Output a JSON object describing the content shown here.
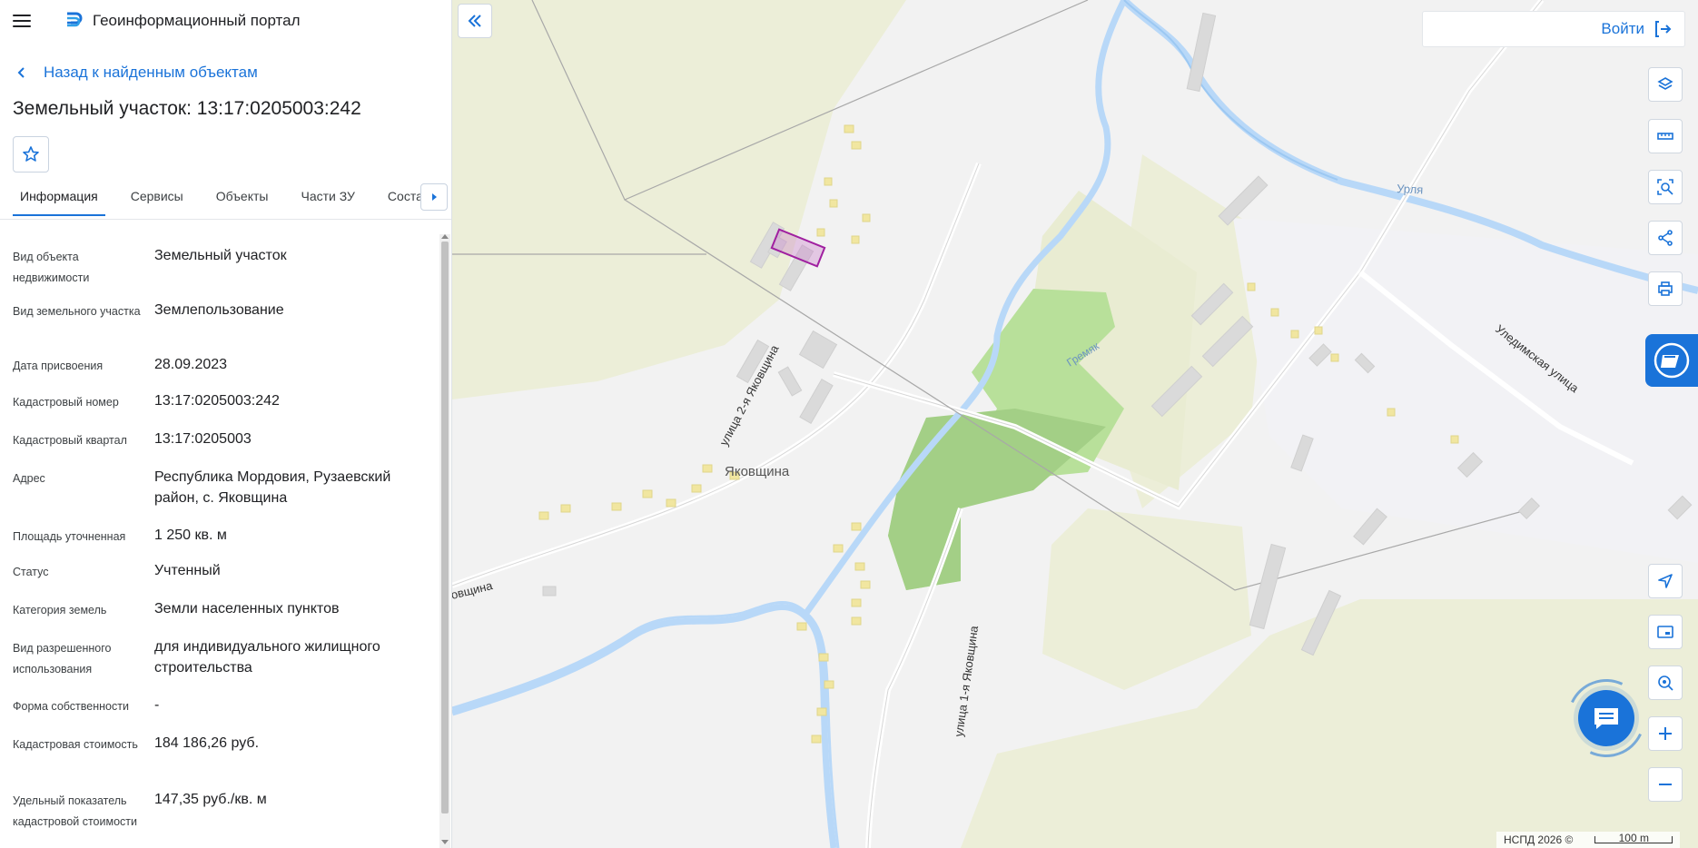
{
  "header": {
    "menu_icon": "hamburger-icon",
    "logo_icon": "portal-logo-icon",
    "title": "Геоинформационный портал"
  },
  "nav": {
    "back_label": "Назад к найденным объектам"
  },
  "object": {
    "title": "Земельный участок: 13:17:0205003:242",
    "favorite_icon": "star-icon"
  },
  "tabs": [
    {
      "label": "Информация",
      "active": true
    },
    {
      "label": "Сервисы"
    },
    {
      "label": "Объекты"
    },
    {
      "label": "Части ЗУ"
    },
    {
      "label": "Состав"
    }
  ],
  "properties": [
    {
      "key": "Вид объекта недвижимости",
      "value": "Земельный участок"
    },
    {
      "key": "Вид земельного участка",
      "value": "Землепользование"
    },
    {
      "key": "Дата присвоения",
      "value": "28.09.2023"
    },
    {
      "key": "Кадастровый номер",
      "value": "13:17:0205003:242"
    },
    {
      "key": "Кадастровый квартал",
      "value": "13:17:0205003"
    },
    {
      "key": "Адрес",
      "value": "Республика Мордовия, Рузаевский район, с. Яковщина"
    },
    {
      "key": "Площадь уточненная",
      "value": "1 250 кв. м"
    },
    {
      "key": "Статус",
      "value": "Учтенный"
    },
    {
      "key": "Категория земель",
      "value": "Земли населенных пунктов"
    },
    {
      "key": "Вид разрешенного использования",
      "value": "для индивидуального жилищного строительства"
    },
    {
      "key": "Форма собственности",
      "value": "-"
    },
    {
      "key": "Кадастровая стоимость",
      "value": "184 186,26 руб."
    },
    {
      "key": "Удельный показатель кадастровой стоимости",
      "value": "147,35 руб./кв. м"
    }
  ],
  "map": {
    "labels": {
      "village": "Яковщина",
      "street_2": "улица 2-я Яковщина",
      "street_1": "улица 1-я Яковщина",
      "street_uled": "Уледимская улица",
      "river_urlya": "Урля",
      "river_gremyak": "Гремяк",
      "road_west": "овщина"
    },
    "colors": {
      "water": "#b8d8f8",
      "forest": "#b8e09a",
      "forest_dark": "#a3cf86",
      "field": "#ecefd8",
      "parcel": "#a020a0",
      "accent": "#1a73d9"
    }
  },
  "controls": {
    "collapse_icon": "double-chevron-left-icon",
    "login_label": "Войти",
    "login_icon": "login-icon",
    "tools": [
      "layers-icon",
      "ruler-icon",
      "search-area-icon",
      "share-icon",
      "print-icon",
      "locate-icon",
      "minimap-icon",
      "geolocation-icon",
      "zoom-in-icon",
      "zoom-out-icon"
    ],
    "assistant_icon": "assistant-icon",
    "chat_icon": "chat-icon"
  },
  "footer": {
    "credit": "НСПД 2026 ©",
    "scale": "100 m"
  }
}
